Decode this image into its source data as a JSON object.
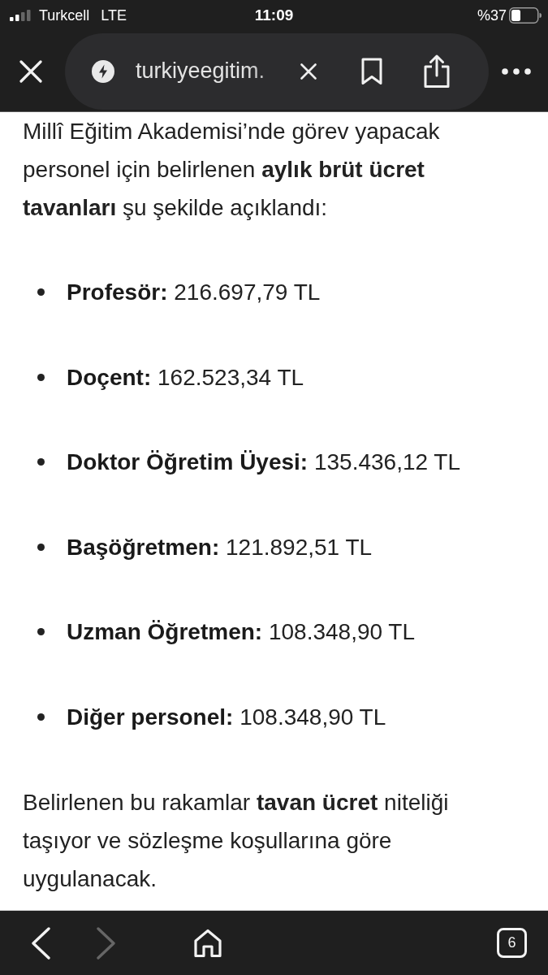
{
  "status_bar": {
    "carrier": "Turkcell",
    "network": "LTE",
    "time": "11:09",
    "battery": "%37"
  },
  "browser_toolbar": {
    "url": "turkiyeegitim."
  },
  "article": {
    "intro": "Millî Eğitim Akademisi’nde görev yapacak personel için belirlenen **aylık brüt ücret tavanları** şu şekilde açıklandı:",
    "salaries": [
      {
        "label": "Profesör:",
        "value": "216.697,79 TL"
      },
      {
        "label": "Doçent:",
        "value": "162.523,34 TL"
      },
      {
        "label": "Doktor Öğretim Üyesi:",
        "value": "135.436,12 TL"
      },
      {
        "label": "Başöğretmen:",
        "value": "121.892,51 TL"
      },
      {
        "label": "Uzman Öğretmen:",
        "value": "108.348,90 TL"
      },
      {
        "label": "Diğer personel:",
        "value": "108.348,90 TL"
      }
    ],
    "closing": "Belirlenen bu rakamlar **tavan ücret** niteliği taşıyor ve sözleşme koşullarına göre uygulanacak."
  },
  "bottom_bar": {
    "buttons": [
      {
        "kind": "back",
        "disabled": false
      },
      {
        "kind": "forward",
        "disabled": true
      },
      {
        "kind": "home",
        "disabled": false
      }
    ],
    "tab_count": "6"
  }
}
